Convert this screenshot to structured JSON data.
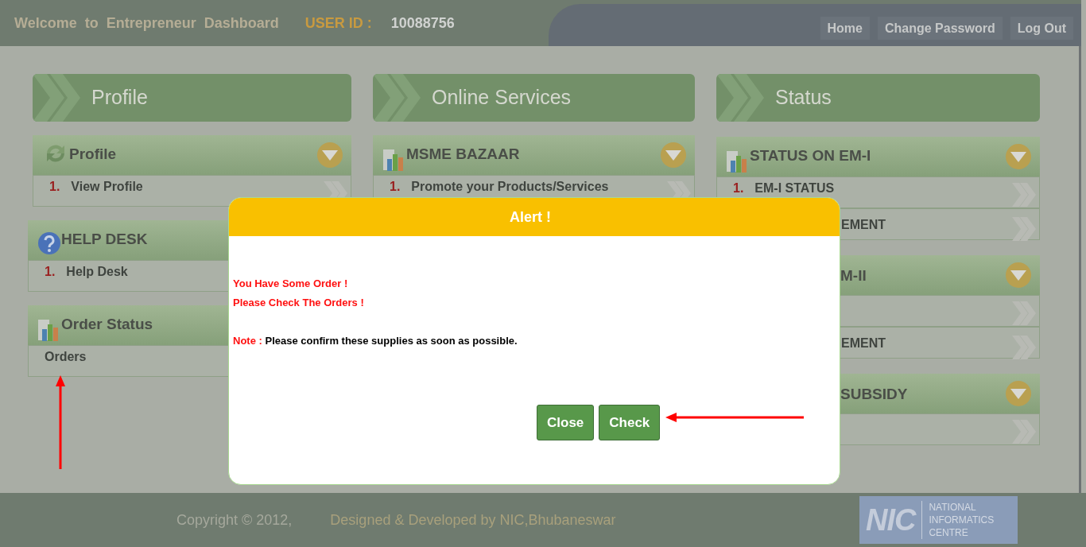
{
  "header": {
    "title": "Welcome  to  Entrepreneur  Dashboard",
    "user_id_label": "USER ID :",
    "user_id": "10088756",
    "nav": [
      "Home",
      "Change Password",
      "Log Out"
    ]
  },
  "columns": [
    {
      "title": "Profile",
      "panels": [
        {
          "title": "Profile",
          "kind": "refresh",
          "items": [
            {
              "kind": "full",
              "number": "1.",
              "label": "View Profile"
            }
          ]
        },
        {
          "title": "HELP DESK",
          "kind": "help",
          "items": [
            {
              "kind": "full",
              "number": "1.",
              "label": "Help Desk"
            }
          ]
        },
        {
          "title": "Order Status",
          "kind": "chart",
          "items": [
            {
              "kind": "full",
              "label": "Orders"
            }
          ]
        }
      ]
    },
    {
      "title": "Online Services",
      "panels": [
        {
          "title": "MSME BAZAAR",
          "kind": "chart",
          "items": [
            {
              "kind": "full",
              "number": "1.",
              "label": "Promote your Products/Services"
            }
          ]
        }
      ]
    },
    {
      "title": "Status",
      "panels": [
        {
          "title": "STATUS ON EM-I",
          "kind": "chart",
          "items": [
            {
              "kind": "full",
              "number": "1.",
              "label": "EM-I STATUS"
            },
            {
              "kind": "clipped",
              "label": "EMENT"
            }
          ]
        },
        {
          "title": "M-II",
          "kind": "clipped",
          "items": [
            {
              "kind": "covered"
            },
            {
              "kind": "clipped",
              "label": "EMENT"
            }
          ]
        },
        {
          "title": "SUBSIDY",
          "kind": "clipped",
          "items": [
            {
              "kind": "covered"
            }
          ]
        }
      ]
    }
  ],
  "dialog": {
    "title": "Alert !",
    "lines": [
      "You Have Some Order !",
      "Please Check The Orders !"
    ],
    "note_label": "Note :",
    "note": "Please confirm these supplies as soon as possible.",
    "buttons": [
      "Close",
      "Check"
    ]
  },
  "footer": {
    "copyright": "Copyright © 2012,",
    "credit": "Designed & Developed by NIC,Bhubaneswar",
    "logo_mark": "NIC",
    "logo_text": [
      "NATIONAL",
      "INFORMATICS",
      "CENTRE"
    ]
  }
}
